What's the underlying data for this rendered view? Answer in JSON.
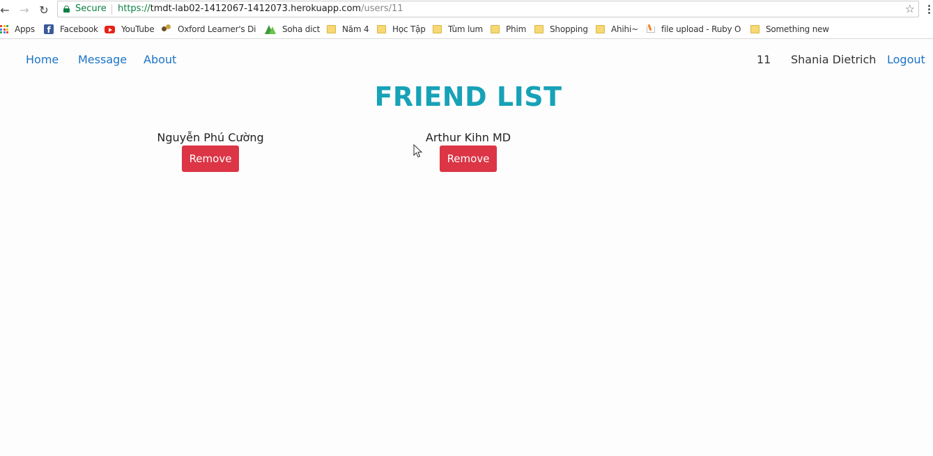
{
  "browser": {
    "secure_label": "Secure",
    "url_scheme": "https://",
    "url_host": "tmdt-lab02-1412067-1412073.herokuapp.com",
    "url_path": "/users/11"
  },
  "bookmarks": [
    {
      "label": "Apps",
      "icon": "apps-icon"
    },
    {
      "label": "Facebook",
      "icon": "facebook-icon"
    },
    {
      "label": "YouTube",
      "icon": "youtube-icon"
    },
    {
      "label": "Oxford Learner's Dicti",
      "icon": "oxford-icon"
    },
    {
      "label": "Soha dict",
      "icon": "soha-icon"
    },
    {
      "label": "Năm 4",
      "icon": "folder-icon"
    },
    {
      "label": "Học Tập",
      "icon": "folder-icon"
    },
    {
      "label": "Tùm lum",
      "icon": "folder-icon"
    },
    {
      "label": "Phim",
      "icon": "folder-icon"
    },
    {
      "label": "Shopping",
      "icon": "folder-icon"
    },
    {
      "label": "Ahihi~",
      "icon": "folder-icon"
    },
    {
      "label": "file upload - Ruby On",
      "icon": "stackoverflow-icon"
    },
    {
      "label": "Something new",
      "icon": "folder-icon"
    }
  ],
  "navbar": {
    "home": "Home",
    "message": "Message",
    "about": "About",
    "user_id": "11",
    "user_name": "Shania Dietrich",
    "logout": "Logout"
  },
  "main": {
    "title": "FRIEND LIST",
    "friends": [
      {
        "name": "Nguyễn Phú Cường",
        "action": "Remove"
      },
      {
        "name": "Arthur Kihn MD",
        "action": "Remove"
      }
    ]
  },
  "colors": {
    "link": "#1a73c8",
    "title": "#17a2b8",
    "danger": "#dc3545",
    "secure": "#0b8043"
  }
}
